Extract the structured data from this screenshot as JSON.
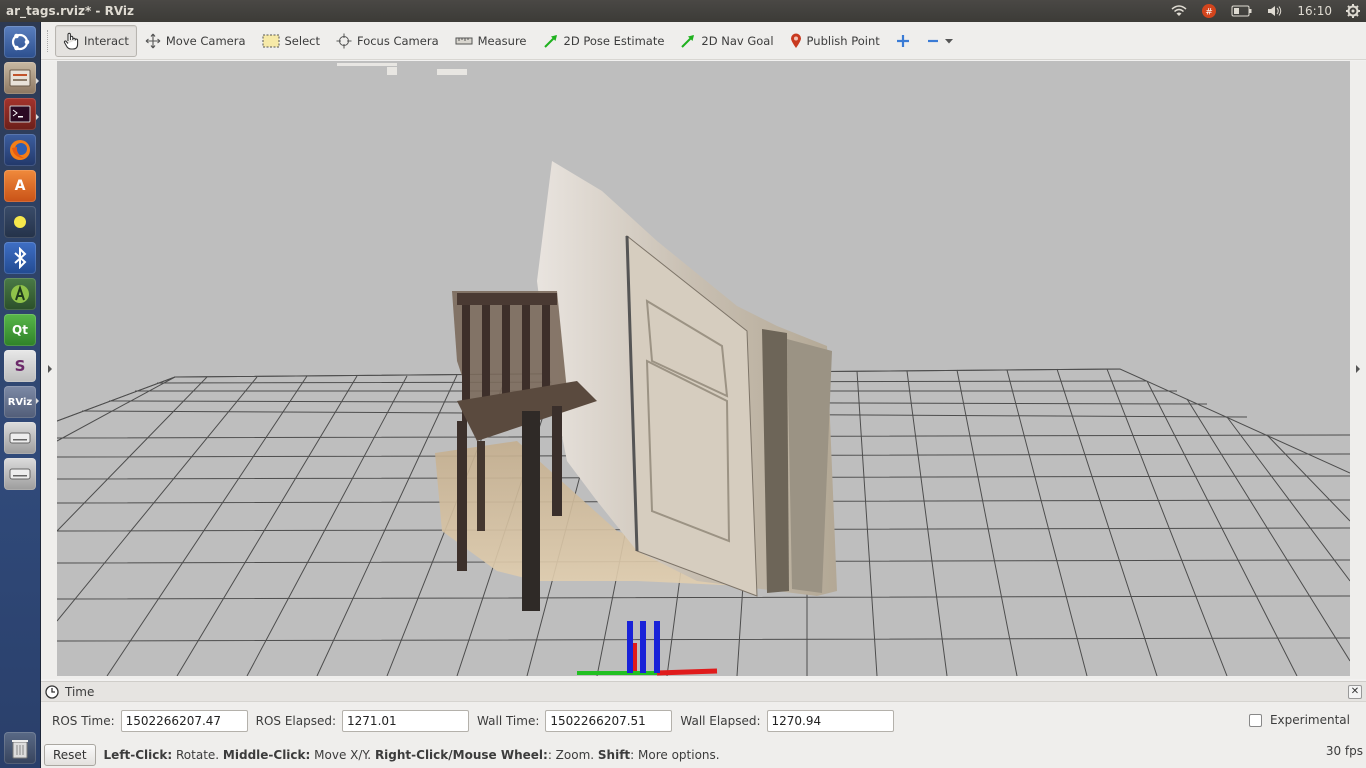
{
  "window": {
    "title": "ar_tags.rviz* - RViz"
  },
  "indicators": {
    "clock": "16:10"
  },
  "launcher": {
    "items": [
      {
        "name": "ubuntu-dash-icon",
        "label": ""
      },
      {
        "name": "file-manager-icon",
        "label": ""
      },
      {
        "name": "terminal-icon",
        "label": ""
      },
      {
        "name": "firefox-icon",
        "label": ""
      },
      {
        "name": "software-center-icon",
        "label": "A"
      },
      {
        "name": "brightness-icon",
        "label": ""
      },
      {
        "name": "bluetooth-icon",
        "label": ""
      },
      {
        "name": "android-studio-icon",
        "label": ""
      },
      {
        "name": "qt-creator-icon",
        "label": "Qt"
      },
      {
        "name": "slack-icon",
        "label": "S"
      },
      {
        "name": "rviz-icon",
        "label": "RViz"
      },
      {
        "name": "drive-icon-1",
        "label": ""
      },
      {
        "name": "drive-icon-2",
        "label": ""
      },
      {
        "name": "trash-icon",
        "label": ""
      }
    ]
  },
  "toolbar": {
    "interact": "Interact",
    "move_camera": "Move Camera",
    "select": "Select",
    "focus_camera": "Focus Camera",
    "measure": "Measure",
    "pose_estimate": "2D Pose Estimate",
    "nav_goal": "2D Nav Goal",
    "publish_point": "Publish Point"
  },
  "time_panel": {
    "title": "Time",
    "ros_time_label": "ROS Time:",
    "ros_time": "1502266207.47",
    "ros_elapsed_label": "ROS Elapsed:",
    "ros_elapsed": "1271.01",
    "wall_time_label": "Wall Time:",
    "wall_time": "1502266207.51",
    "wall_elapsed_label": "Wall Elapsed:",
    "wall_elapsed": "1270.94",
    "experimental_label": "Experimental"
  },
  "status": {
    "reset": "Reset",
    "left_click_key": "Left-Click:",
    "left_click_val": " Rotate. ",
    "middle_click_key": "Middle-Click:",
    "middle_click_val": " Move X/Y. ",
    "right_click_key": "Right-Click/Mouse Wheel:",
    "right_click_val": ": Zoom. ",
    "shift_key": "Shift",
    "shift_val": ": More options.",
    "fps": "30 fps"
  }
}
